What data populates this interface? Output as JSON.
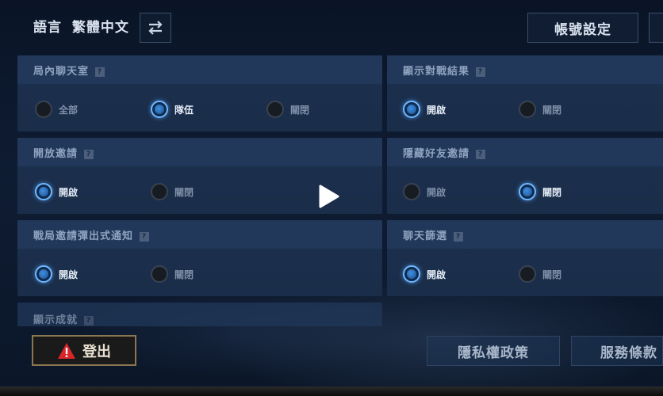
{
  "header": {
    "language_label": "語言",
    "language_value": "繁體中文",
    "account_settings": "帳號設定"
  },
  "panels": [
    {
      "title": "局內聊天室",
      "help": "?",
      "options": [
        {
          "label": "全部",
          "selected": false
        },
        {
          "label": "隊伍",
          "selected": true
        },
        {
          "label": "關閉",
          "selected": false
        }
      ]
    },
    {
      "title": "顯示對戰結果",
      "help": "?",
      "options": [
        {
          "label": "開啟",
          "selected": true
        },
        {
          "label": "關閉",
          "selected": false
        }
      ]
    },
    {
      "title": "開放邀請",
      "help": "?",
      "options": [
        {
          "label": "開啟",
          "selected": true
        },
        {
          "label": "關閉",
          "selected": false
        }
      ]
    },
    {
      "title": "隱藏好友邀請",
      "help": "?",
      "options": [
        {
          "label": "開啟",
          "selected": false
        },
        {
          "label": "關閉",
          "selected": true
        }
      ]
    },
    {
      "title": "戰局邀請彈出式通知",
      "help": "?",
      "options": [
        {
          "label": "開啟",
          "selected": true
        },
        {
          "label": "關閉",
          "selected": false
        }
      ]
    },
    {
      "title": "聊天篩選",
      "help": "?",
      "options": [
        {
          "label": "開啟",
          "selected": true
        },
        {
          "label": "關閉",
          "selected": false
        }
      ]
    },
    {
      "title": "顯示成就",
      "help": "?",
      "options": []
    }
  ],
  "footer": {
    "logout": "登出",
    "privacy_policy": "隱私權政策",
    "terms_of_service": "服務條款"
  },
  "icons": {
    "swap": "swap-arrows-icon",
    "warning": "warning-triangle-icon",
    "play": "play-icon"
  },
  "colors": {
    "accent": "#6fb7ff",
    "logout_border": "#8a7650",
    "warning": "#d9262b"
  }
}
